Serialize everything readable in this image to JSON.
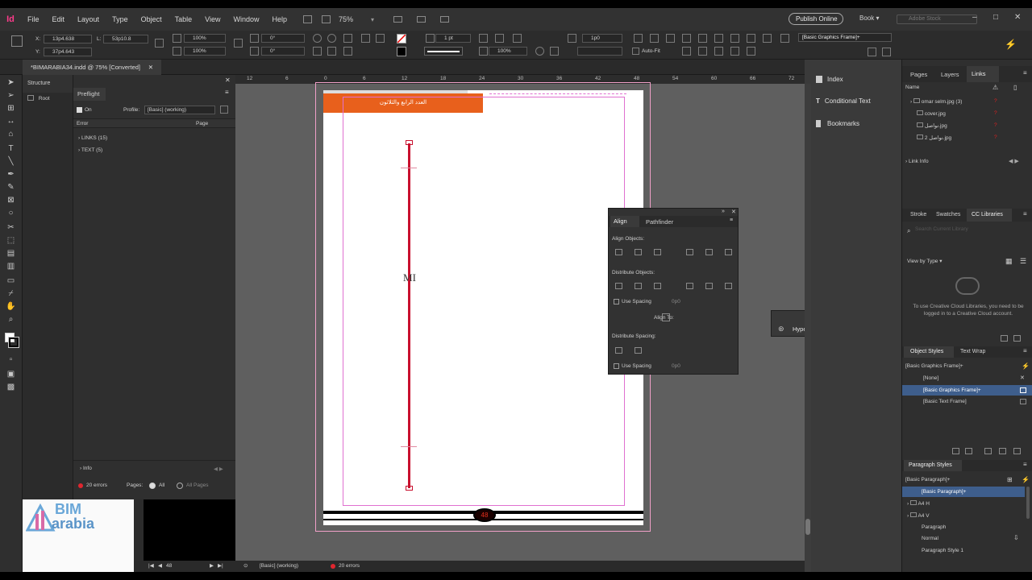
{
  "menubar": {
    "logo": "Id",
    "items": [
      "File",
      "Edit",
      "Layout",
      "Type",
      "Object",
      "Table",
      "View",
      "Window",
      "Help"
    ],
    "zoom": "75%",
    "publish_label": "Publish Online",
    "workspace": "Book",
    "stock_placeholder": "Adobe Stock"
  },
  "control": {
    "x": "13p4.638",
    "y": "37p4.643",
    "l": "53p10.8",
    "w_scale": "100%",
    "h_scale": "100%",
    "angle1": "0°",
    "angle2": "0°",
    "stroke_weight": "1 pt",
    "opacity": "100%",
    "offset": "1p0",
    "autofit": "Auto-Fit",
    "style": "[Basic Graphics Frame]+"
  },
  "doc_tab": "*BIMARABIA34.indd @ 75% [Converted]",
  "structure": {
    "header": "Structure",
    "root": "Root"
  },
  "preflight": {
    "tab": "Preflight",
    "on_label": "On",
    "profile_label": "Profile:",
    "profile_value": "[Basic] (working)",
    "col_error": "Error",
    "col_page": "Page",
    "rows": [
      "LINKS (15)",
      "TEXT (5)"
    ],
    "info": "Info",
    "errors": "20 errors",
    "pages_label": "Pages:",
    "all": "All",
    "all_pages": "All Pages"
  },
  "ruler": [
    "12",
    "6",
    "0",
    "6",
    "12",
    "18",
    "24",
    "30",
    "36",
    "42",
    "48",
    "54",
    "60",
    "66",
    "72"
  ],
  "page": {
    "orange_text": "العدد الرابع والثلاثون",
    "vertical_text": "MI",
    "page_number": "48"
  },
  "logo": {
    "top": "BIM",
    "bottom": "arabia"
  },
  "align": {
    "tab1": "Align",
    "tab2": "Pathfinder",
    "align_objects": "Align Objects:",
    "distribute_objects": "Distribute Objects:",
    "use_spacing": "Use Spacing",
    "spacing_value": "0p0",
    "align_to": "Align To:",
    "distribute_spacing": "Distribute Spacing:",
    "use_spacing2": "Use Spacing",
    "spacing_value2": "0p0"
  },
  "hyperlinks": "Hyperlinks",
  "dock": [
    "Index",
    "Conditional Text",
    "Bookmarks"
  ],
  "links_panel": {
    "tabs": [
      "Pages",
      "Layers",
      "Links"
    ],
    "name_col": "Name",
    "items": [
      "omar selm.jpg (3)",
      "cover.jpg",
      "نواصل.jpg",
      "2 نواصل.jpg"
    ],
    "link_info": "Link Info"
  },
  "cc_panel": {
    "tabs": [
      "Stroke",
      "Swatches",
      "CC Libraries"
    ],
    "search_placeholder": "Search Current Library",
    "view_by": "View by Type",
    "message": "To use Creative Cloud Libraries, you need to be logged in to a Creative Cloud account."
  },
  "object_styles": {
    "tabs": [
      "Object Styles",
      "Text Wrap"
    ],
    "current": "[Basic Graphics Frame]+",
    "items": [
      "[None]",
      "[Basic Graphics Frame]+",
      "[Basic Text Frame]"
    ]
  },
  "paragraph_styles": {
    "title": "Paragraph Styles",
    "current": "[Basic Paragraph]+",
    "items": [
      "[Basic Paragraph]+",
      "A4 H",
      "A4 V",
      "Paragraph",
      "Normal",
      "Paragraph Style 1"
    ]
  },
  "status": {
    "page": "48",
    "profile": "[Basic] (working)",
    "errors": "20 errors"
  },
  "colors": {
    "accent": "#e8601c",
    "guide": "#ff00ff",
    "line": "#c8102e",
    "panel": "#2f2f2f"
  }
}
